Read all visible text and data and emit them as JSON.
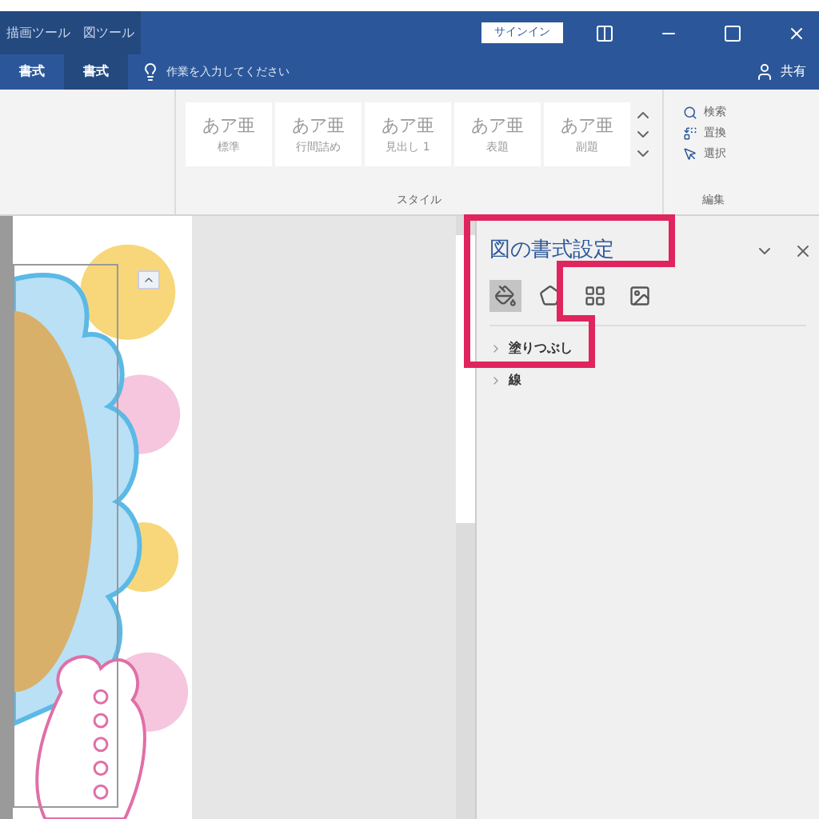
{
  "title_bar": {
    "context_tabs": [
      "描画ツール",
      "図ツール"
    ],
    "sign_in": "サインイン"
  },
  "ribbon_tabs": [
    {
      "label": "書式",
      "selected": false
    },
    {
      "label": "書式",
      "selected": true
    }
  ],
  "tell_me": {
    "placeholder": "作業を入力してください"
  },
  "share": "共有",
  "styles": {
    "label": "スタイル",
    "items": [
      {
        "sample": "あア亜",
        "name": "標準"
      },
      {
        "sample": "あア亜",
        "name": "行間詰め"
      },
      {
        "sample": "あア亜",
        "name": "見出し 1"
      },
      {
        "sample": "あア亜",
        "name": "表題"
      },
      {
        "sample": "あア亜",
        "name": "副題"
      }
    ]
  },
  "editing": {
    "label": "編集",
    "commands": [
      "検索",
      "置換",
      "選択"
    ]
  },
  "pane": {
    "title": "図の書式設定",
    "tabs": [
      {
        "kind": "fill",
        "selected": true
      },
      {
        "kind": "effects",
        "selected": false
      },
      {
        "kind": "layout",
        "selected": false
      },
      {
        "kind": "picture",
        "selected": false
      }
    ],
    "sections": [
      {
        "label": "塗りつぶし",
        "expanded": false
      },
      {
        "label": "線",
        "expanded": false
      }
    ]
  }
}
